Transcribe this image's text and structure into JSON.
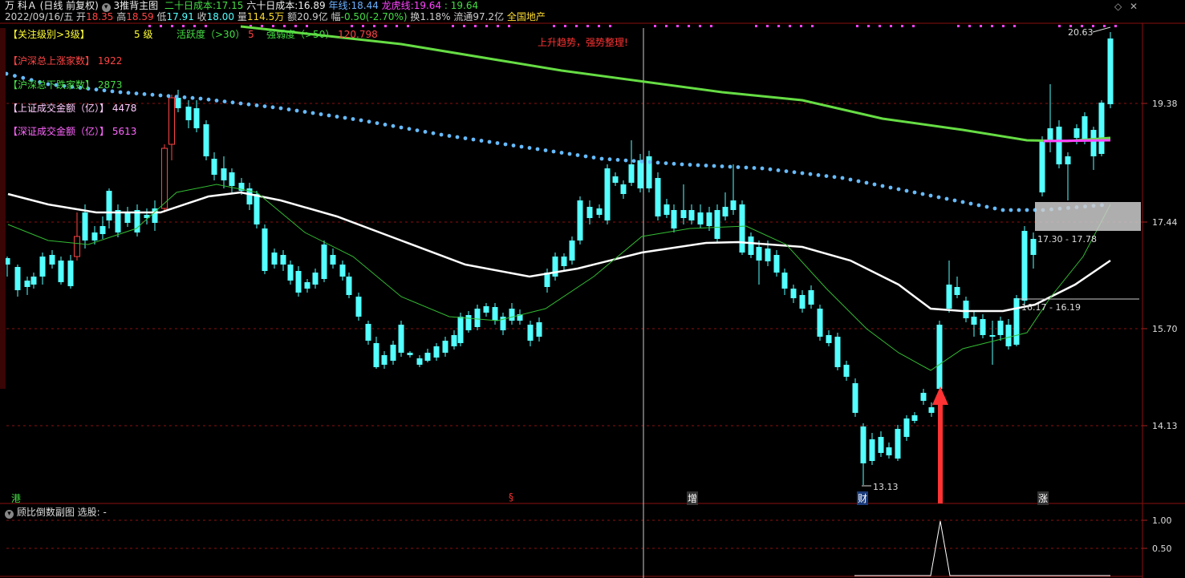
{
  "header": {
    "stock_name": "万 科Ａ",
    "period": "(日线 前复权)",
    "indicator_name": "3推背主图",
    "cost20_label": "二十日成本:",
    "cost20_value": "17.15",
    "cost60_label": "六十日成本:",
    "cost60_value": "16.89",
    "year_label": "年线:",
    "year_value": "18.44",
    "dragon_label": "龙虎线:",
    "dragon_value": "19.64",
    "dragon_value2": ": 19.64",
    "date": "2022/09/16/五",
    "open_label": "开",
    "open_value": "18.35",
    "high_label": "高",
    "high_value": "18.59",
    "low_label": "低",
    "low_value": "17.91",
    "close_label": "收",
    "close_value": "18.00",
    "vol_label": "量",
    "vol_value": "114.5万",
    "amount_label": "额",
    "amount_value": "20.9亿",
    "change_label": "幅",
    "change_value": "-0.50(-2.70%)",
    "turnover_label": "换",
    "turnover_value": "1.18%",
    "float_label": "流通",
    "float_value": "97.2亿",
    "sector": "全国地产"
  },
  "info": {
    "level_label": "【关注级别>3级】",
    "level_value": "5  级",
    "activity_label": "活跃度（>30）",
    "activity_value": "5",
    "strength_label": "强弱度（>50）",
    "strength_value": "120.798",
    "up_label": "【沪深总上涨家数】",
    "up_value": "1922",
    "down_label": "【沪深总下跌家数】",
    "down_value": "2873",
    "sh_label": "【上证成交金额（亿）】",
    "sh_value": "4478",
    "sz_label": "【深证成交金额（亿）】",
    "sz_value": "5613",
    "trend_text": "上升趋势，强势整理!"
  },
  "price_axis": [
    "19.38",
    "17.44",
    "15.70",
    "14.13"
  ],
  "annotations": {
    "high_mark": "20.63",
    "low_mark": "13.13",
    "zone_upper": "17.30 - 17.78",
    "zone_lower": "16.17 - 16.19"
  },
  "event_tags": [
    {
      "text": "港",
      "color": "#44dd44"
    },
    {
      "text": "§",
      "color": "#ff3333"
    },
    {
      "text": "增",
      "color": "#ffffff"
    },
    {
      "text": "财",
      "color": "#ffffff"
    },
    {
      "text": "涨",
      "color": "#ffffff"
    }
  ],
  "sub_chart": {
    "title": "顾比倒数副图",
    "select_label": "选股: -",
    "axis": [
      "1.00",
      "0.50"
    ]
  },
  "colors": {
    "up": "#ff4444",
    "down": "#54ffff",
    "ma_green": "#44dd44",
    "dot_line": "#66bbff",
    "magenta": "#ff44ff",
    "grid_red": "#8b1010"
  },
  "window": {
    "restore_icon": "◇",
    "close_icon": "✕"
  }
}
